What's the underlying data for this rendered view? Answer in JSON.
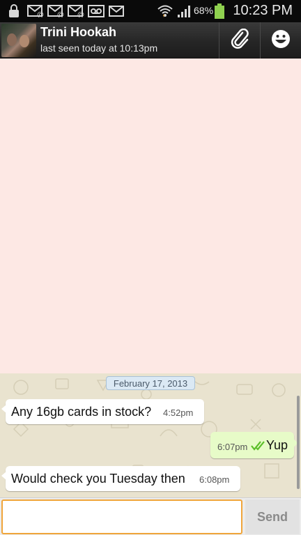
{
  "status_bar": {
    "battery_percent": "68%",
    "time": "10:23 PM",
    "icons": [
      "lock-icon",
      "missed-mail-icon",
      "missed-mail-icon",
      "missed-mail-icon",
      "voicemail-icon",
      "email-icon",
      "wifi-icon",
      "signal-icon",
      "battery-icon"
    ]
  },
  "header": {
    "contact_name": "Trini Hookah",
    "last_seen": "last seen today at 10:13pm",
    "actions": [
      "attach-icon",
      "smiley-icon"
    ]
  },
  "chat": {
    "date_label": "February 17, 2013",
    "messages": [
      {
        "direction": "incoming",
        "text": "Any 16gb cards in stock?",
        "time": "4:52pm"
      },
      {
        "direction": "outgoing",
        "text": "Yup",
        "time": "6:07pm",
        "status": "delivered"
      },
      {
        "direction": "incoming",
        "text": "Would check you Tuesday then",
        "time": "6:08pm"
      }
    ]
  },
  "composer": {
    "input_value": "",
    "send_label": "Send"
  },
  "colors": {
    "accent_input_border": "#f0a53a",
    "outgoing_bubble": "#e7fbc8",
    "incoming_bubble": "#ffffff",
    "tick_green": "#5cbf2a",
    "battery_green": "#8fd14f"
  }
}
